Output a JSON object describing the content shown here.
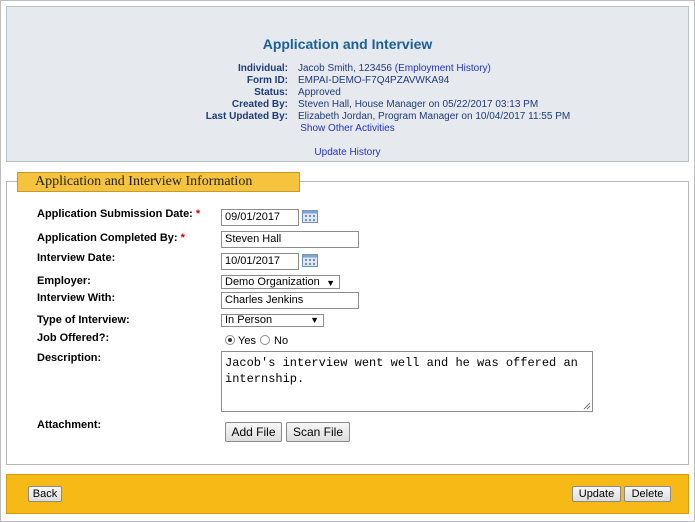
{
  "header": {
    "title": "Application and Interview",
    "individual_label": "Individual:",
    "individual_value": "Jacob Smith, 123456",
    "employment_history_link": "(Employment History)",
    "form_id_label": "Form ID:",
    "form_id_value": "EMPAI-DEMO-F7Q4PZAVWKA94",
    "status_label": "Status:",
    "status_value": "Approved",
    "created_by_label": "Created By:",
    "created_by_value": "Steven Hall, House Manager on 05/22/2017 03:13 PM",
    "last_updated_label": "Last Updated By:",
    "last_updated_value": "Elizabeth Jordan, Program Manager on 10/04/2017 11:55 PM",
    "show_activities_link": "Show Other Activities",
    "update_history_link": "Update History"
  },
  "section": {
    "title": "Application and Interview Information",
    "required_marker": "*",
    "fields": {
      "submission_date_label": "Application Submission Date:",
      "submission_date_value": "09/01/2017",
      "completed_by_label": "Application Completed By:",
      "completed_by_value": "Steven Hall",
      "interview_date_label": "Interview Date:",
      "interview_date_value": "10/01/2017",
      "employer_label": "Employer:",
      "employer_value": "Demo Organization",
      "interview_with_label": "Interview With:",
      "interview_with_value": "Charles Jenkins",
      "type_label": "Type of Interview:",
      "type_value": "In Person",
      "job_offered_label": "Job Offered?:",
      "job_offered_yes": "Yes",
      "job_offered_no": "No",
      "job_offered_selected": "Yes",
      "description_label": "Description:",
      "description_value": "Jacob's interview went well and he was offered an internship.",
      "attachment_label": "Attachment:",
      "add_file_button": "Add File",
      "scan_file_button": "Scan File"
    }
  },
  "footer": {
    "back_button": "Back",
    "update_button": "Update",
    "delete_button": "Delete"
  },
  "icons": {
    "calendar": "calendar-icon",
    "dropdown": "chevron-down-icon",
    "resize": "resize-grip-icon"
  },
  "colors": {
    "header_bg": "#e6e9ee",
    "title_color": "#1b5f96",
    "accent_yellow": "#f7b916",
    "legend_yellow": "#f6c33f",
    "required_red": "#cc0000",
    "link_blue": "#2233bb"
  }
}
